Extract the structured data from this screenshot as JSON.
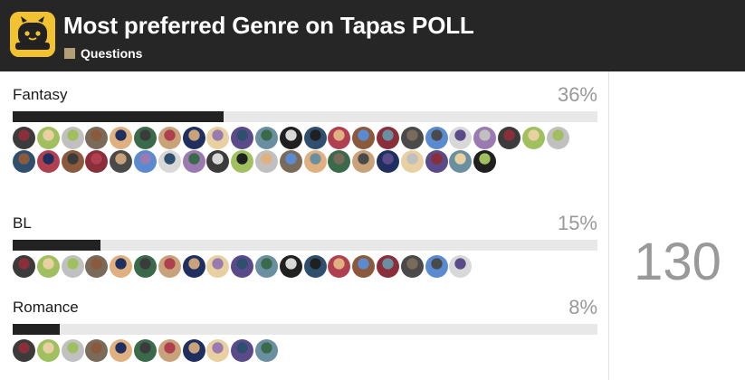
{
  "header": {
    "title": "Most preferred Genre on Tapas POLL",
    "category": "Questions",
    "accent": "#b29f76",
    "logo_color": "#f2c230"
  },
  "options": [
    {
      "label": "Fantasy",
      "percent_text": "36%",
      "percent": 36,
      "avatar_count": 43
    },
    {
      "label": "BL",
      "percent_text": "15%",
      "percent": 15,
      "avatar_count": 19
    },
    {
      "label": "Romance",
      "percent_text": "8%",
      "percent": 8,
      "avatar_count": 11
    }
  ],
  "total_votes": "130",
  "colors": {
    "header_bg": "#262626",
    "bar_fill": "#222222",
    "bar_track": "#e8e8e8",
    "muted_text": "#999999"
  }
}
